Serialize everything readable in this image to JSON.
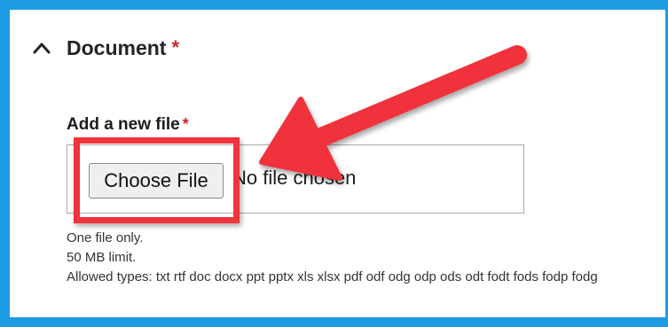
{
  "section": {
    "title": "Document",
    "required_mark": "*",
    "expanded_icon": "chevron-up-icon"
  },
  "field": {
    "label": "Add a new file",
    "required_mark": "*",
    "button_label": "Choose File",
    "status_text": "No file chosen"
  },
  "description": {
    "line1": "One file only.",
    "line2": "50 MB limit.",
    "line3": "Allowed types: txt rtf doc docx ppt pptx xls xlsx pdf odf odg odp ods odt fodt fods fodp fodg"
  },
  "annotation": {
    "color": "#f0333c",
    "shape": "arrow-icon"
  },
  "colors": {
    "frame_border": "#1e9be5",
    "required": "#d72222"
  }
}
